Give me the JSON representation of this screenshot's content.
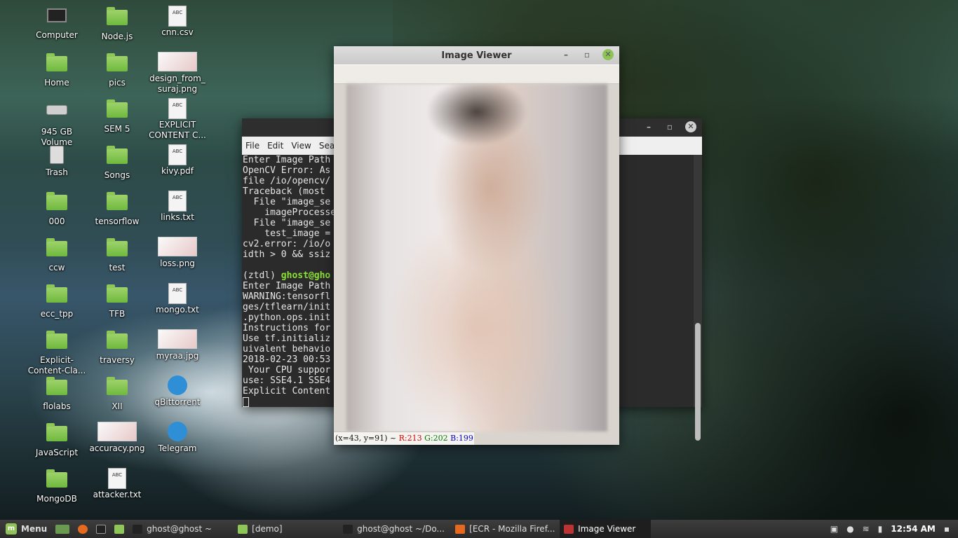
{
  "desktop_icons": [
    {
      "label": "Computer",
      "type": "computer"
    },
    {
      "label": "Node.js",
      "type": "folder"
    },
    {
      "label": "cnn.csv",
      "type": "doc"
    },
    {
      "label": "Home",
      "type": "folder"
    },
    {
      "label": "pics",
      "type": "folder"
    },
    {
      "label": "design_from_\nsuraj.png",
      "type": "image"
    },
    {
      "label": "945 GB\nVolume",
      "type": "drive"
    },
    {
      "label": "SEM 5",
      "type": "folder"
    },
    {
      "label": "EXPLICIT\nCONTENT C...",
      "type": "doc"
    },
    {
      "label": "Trash",
      "type": "trash"
    },
    {
      "label": "Songs",
      "type": "folder"
    },
    {
      "label": "kivy.pdf",
      "type": "doc"
    },
    {
      "label": "000",
      "type": "folder"
    },
    {
      "label": "tensorflow",
      "type": "folder"
    },
    {
      "label": "links.txt",
      "type": "doc"
    },
    {
      "label": "ccw",
      "type": "folder"
    },
    {
      "label": "test",
      "type": "folder"
    },
    {
      "label": "loss.png",
      "type": "image"
    },
    {
      "label": "ecc_tpp",
      "type": "folder"
    },
    {
      "label": "TFB",
      "type": "folder"
    },
    {
      "label": "mongo.txt",
      "type": "doc"
    },
    {
      "label": "Explicit-\nContent-Cla...",
      "type": "folder"
    },
    {
      "label": "traversy",
      "type": "folder"
    },
    {
      "label": "myraa.jpg",
      "type": "image"
    },
    {
      "label": "flolabs",
      "type": "folder"
    },
    {
      "label": "XII",
      "type": "folder"
    },
    {
      "label": "qBittorrent",
      "type": "app"
    },
    {
      "label": "JavaScript",
      "type": "folder"
    },
    {
      "label": "accuracy.png",
      "type": "image"
    },
    {
      "label": "Telegram",
      "type": "app"
    },
    {
      "label": "MongoDB",
      "type": "folder"
    },
    {
      "label": "attacker.txt",
      "type": "doc"
    }
  ],
  "terminal": {
    "menu": [
      "File",
      "Edit",
      "View",
      "Sear"
    ],
    "lines": [
      "Enter Image Path",
      "OpenCV Error: As                                  ) in resize,",
      "file /io/opencv/",
      "Traceback (most",
      "  File \"image_se",
      "    imageProcesse",
      "  File \"image_se",
      "    test_image =",
      "cv2.error: /io/o                                  -215) ssize.w",
      "idth > 0 && ssiz",
      "",
      "(ztdl) ",
      "Enter Image Path",
      "WARNING:tensorfl                                  .5/site-packa",
      "ges/tflearn/init                                  om tensorflow",
      ".python.ops.init                                   version.",
      "Instructions for",
      "Use tf.initializ                                  orm to get eq",
      "uivalent behavio",
      "2018-02-23 00:53                                  guard.cc:137]",
      " Your CPU suppor                                   compiled to",
      "use: SSE4.1 SSE4",
      "Explicit Content"
    ],
    "prompt_user": "ghost@gho"
  },
  "image_viewer": {
    "title": "Image Viewer",
    "status_coords": "(x=43, y=91) ~",
    "status_r": "R:213",
    "status_g": "G:202",
    "status_b": "B:199"
  },
  "taskbar": {
    "menu_label": "Menu",
    "items": [
      {
        "label": "ghost@ghost ~",
        "icon": "terminal-icon"
      },
      {
        "label": "[demo]",
        "icon": "folder-icon"
      },
      {
        "label": "ghost@ghost ~/Do...",
        "icon": "terminal-icon"
      },
      {
        "label": "[ECR - Mozilla Firef...",
        "icon": "firefox-icon"
      },
      {
        "label": "Image Viewer",
        "icon": "image-viewer-icon"
      }
    ],
    "clock": "12:54 AM"
  }
}
